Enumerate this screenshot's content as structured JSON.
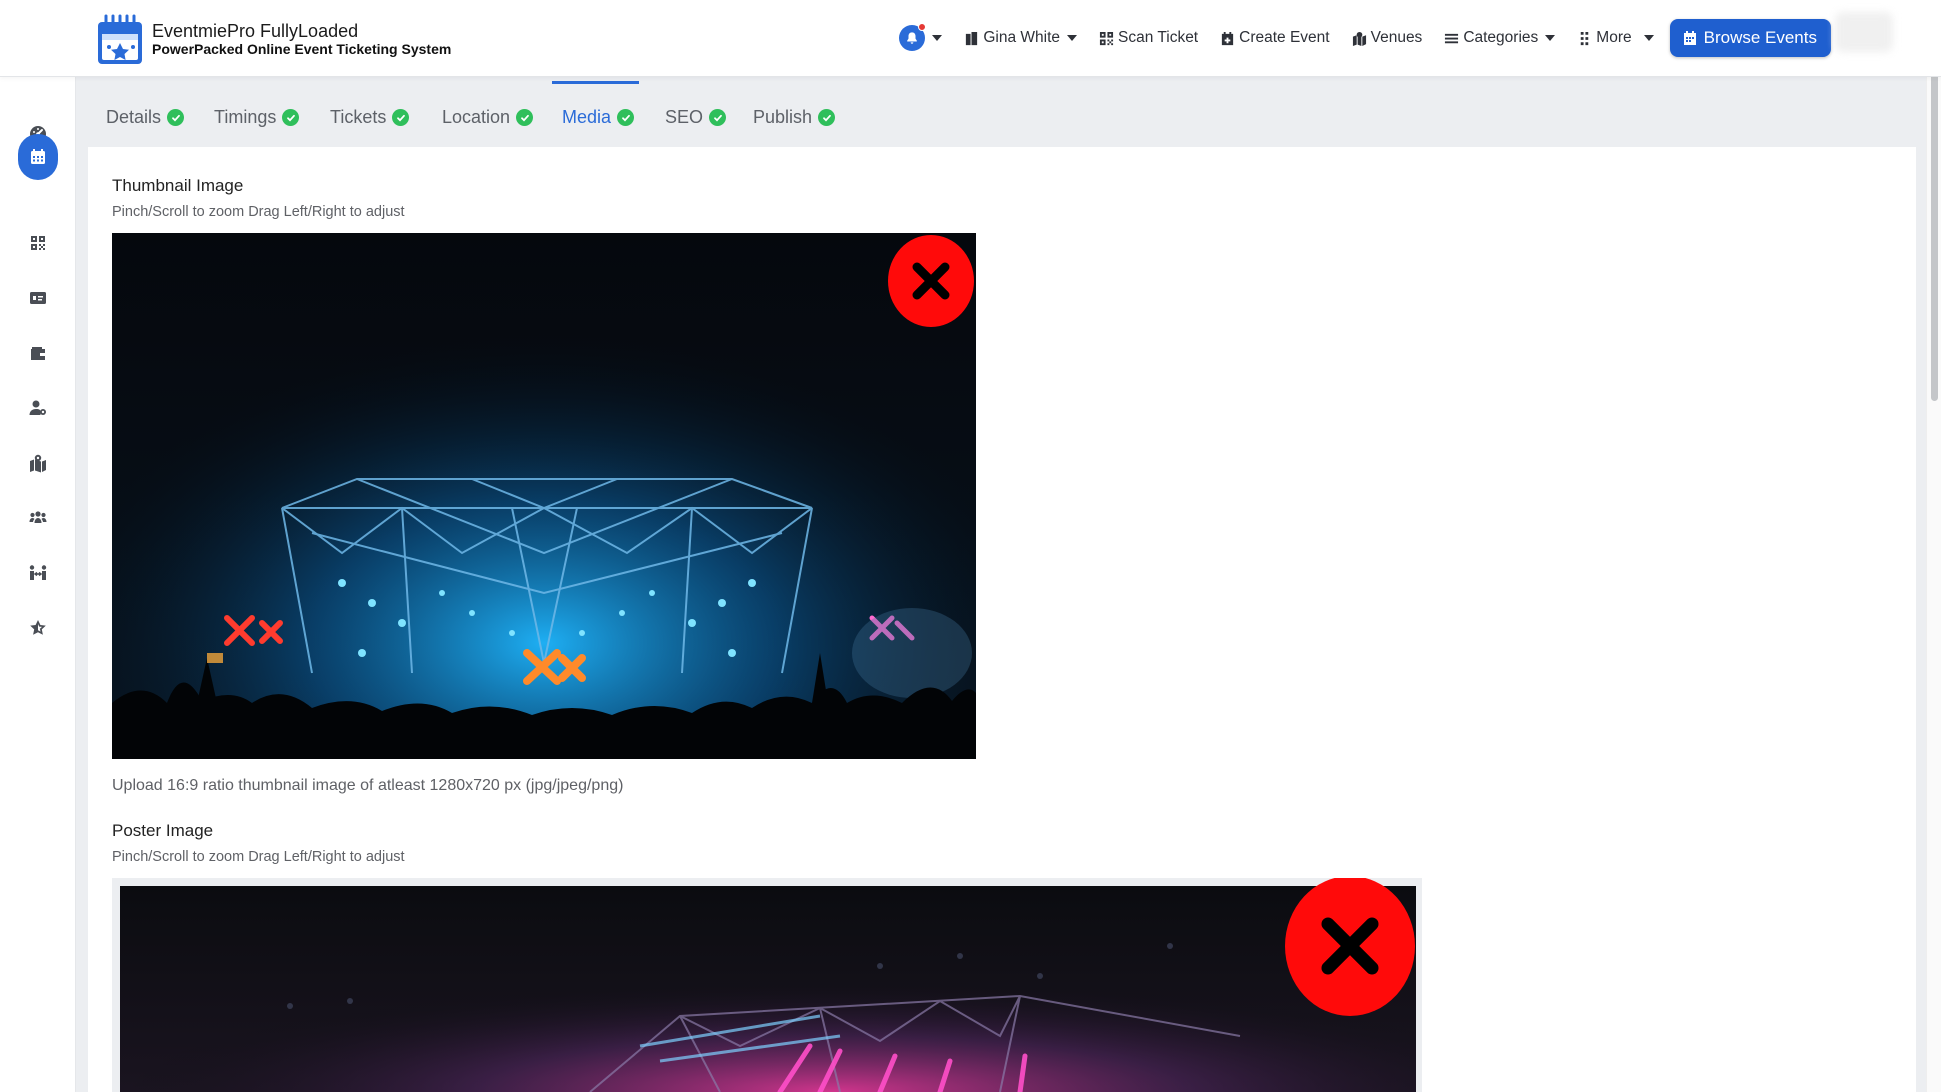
{
  "brand": {
    "title": "EventmiePro FullyLoaded",
    "subtitle": "PowerPacked Online Event Ticketing System"
  },
  "nav": {
    "user_label": "Gina White",
    "scan_ticket": "Scan Ticket",
    "create_event": "Create Event",
    "venues": "Venues",
    "categories": "Categories",
    "more": "More",
    "browse_events": "Browse Events"
  },
  "tabs": [
    {
      "label": "Details",
      "active": false
    },
    {
      "label": "Timings",
      "active": false
    },
    {
      "label": "Tickets",
      "active": false
    },
    {
      "label": "Location",
      "active": false
    },
    {
      "label": "Media",
      "active": true
    },
    {
      "label": "SEO",
      "active": false
    },
    {
      "label": "Publish",
      "active": false
    }
  ],
  "media": {
    "thumbnail": {
      "label": "Thumbnail Image",
      "hint": "Pinch/Scroll to zoom Drag Left/Right to adjust",
      "help": "Upload 16:9 ratio thumbnail image of atleast 1280x720 px (jpg/jpeg/png)"
    },
    "poster": {
      "label": "Poster Image",
      "hint": "Pinch/Scroll to zoom Drag Left/Right to adjust"
    }
  },
  "sidebar_icons": [
    "dashboard-icon",
    "calendar-icon",
    "qrcode-icon",
    "ticket-icon",
    "wallet-icon",
    "user-icon",
    "map-icon",
    "users-icon",
    "people-icon",
    "star-icon"
  ],
  "colors": {
    "accent": "#2a6bd8",
    "success": "#2fbf5b",
    "remove": "#ff0a0a"
  }
}
